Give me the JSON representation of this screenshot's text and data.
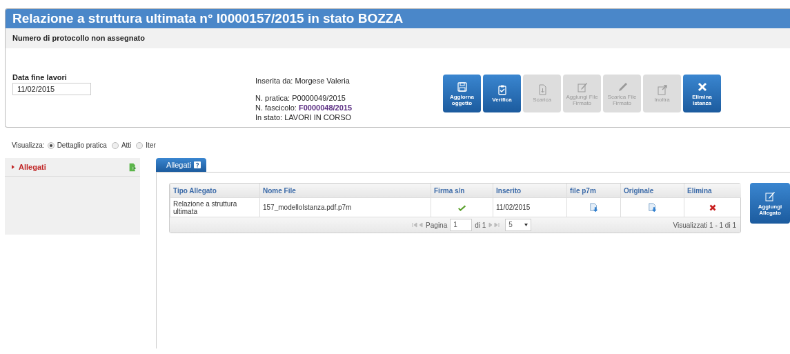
{
  "header": {
    "title": "Relazione a struttura ultimata n° I0000157/2015 in stato BOZZA",
    "subtitle": "Numero di protocollo non assegnato"
  },
  "form": {
    "date_label": "Data fine lavori",
    "date_value": "11/02/2015"
  },
  "info": [
    "Inserita da: Morgese Valeria",
    "N. pratica: P0000049/2015",
    "N. fascicolo: **F0000048/2015**",
    "In stato: LAVORI IN CORSO"
  ],
  "actions": [
    {
      "label": "Aggiorna oggetto",
      "disabled": false
    },
    {
      "label": "Verifica",
      "disabled": false
    },
    {
      "label": "Scarica",
      "disabled": true
    },
    {
      "label": "Aggiungi File Firmato",
      "disabled": true
    },
    {
      "label": "Scarica File Firmato",
      "disabled": true
    },
    {
      "label": "Inoltra",
      "disabled": true
    },
    {
      "label": "Elimina Istanza",
      "disabled": false
    }
  ],
  "view": {
    "label": "Visualizza:",
    "options": [
      {
        "label": "Dettaglio pratica",
        "selected": true
      },
      {
        "label": "Atti",
        "selected": false
      },
      {
        "label": "Iter",
        "selected": false
      }
    ]
  },
  "sidebar": {
    "items": [
      {
        "label": "Allegati",
        "selected": true
      }
    ]
  },
  "tabs": [
    {
      "label": "Allegati",
      "selected": true
    }
  ],
  "table": {
    "columns": [
      "Tipo Allegato",
      "Nome File",
      "Firma s/n",
      "Inserito",
      "file p7m",
      "Originale",
      "Elimina"
    ],
    "rows": [
      {
        "tipo": "Relazione a struttura ultimata",
        "nome_file": "157_modelloIstanza.pdf.p7m",
        "signed": true,
        "inserito": "11/02/2015"
      }
    ],
    "pager": {
      "page_label": "Pagina",
      "page": "1",
      "page_total": "di 1",
      "page_size": "5",
      "summary": "Visualizzati 1 - 1 di 1"
    }
  },
  "add_button": {
    "label": "Aggiungi Allegato"
  }
}
